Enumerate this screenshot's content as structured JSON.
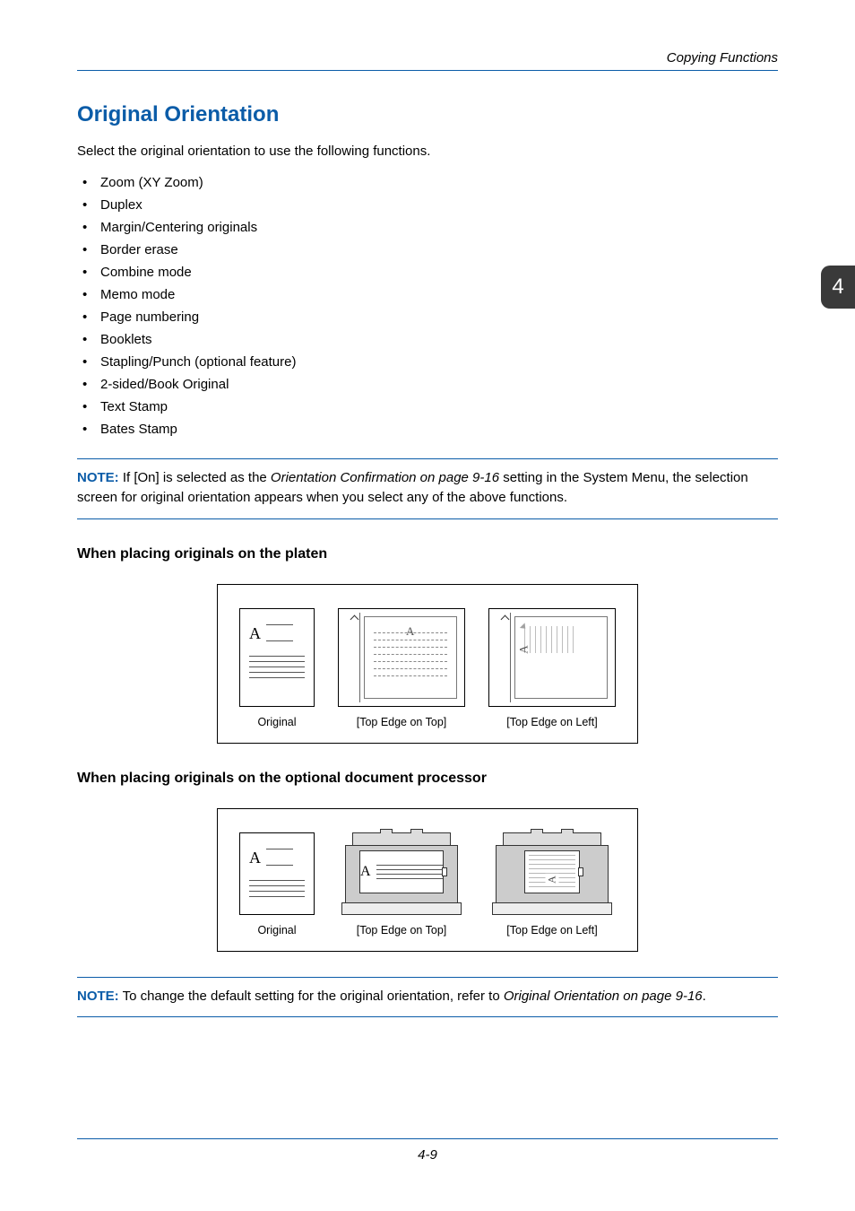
{
  "running_head": "Copying Functions",
  "side_tab": "4",
  "title": "Original Orientation",
  "intro": "Select the original orientation to use the following functions.",
  "bullets": [
    "Zoom (XY Zoom)",
    "Duplex",
    "Margin/Centering originals",
    "Border erase",
    "Combine mode",
    "Memo mode",
    "Page numbering",
    "Booklets",
    "Stapling/Punch (optional feature)",
    "2-sided/Book Original",
    "Text Stamp",
    "Bates Stamp"
  ],
  "note1": {
    "label": "NOTE:",
    "before": " If [On] is selected as the ",
    "italic": "Orientation Confirmation on page 9-16",
    "after": " setting in the System Menu, the selection screen for original orientation appears when you select any of the above functions."
  },
  "subhead1": "When placing originals on the platen",
  "fig1": {
    "c1": "Original",
    "c2": "[Top Edge on Top]",
    "c3": "[Top Edge on Left]"
  },
  "subhead2": "When placing originals on the optional document processor",
  "fig2": {
    "c1": "Original",
    "c2": "[Top Edge on Top]",
    "c3": "[Top Edge on Left]"
  },
  "note2": {
    "label": "NOTE:",
    "before": " To change the default setting for the original orientation, refer to ",
    "italic": "Original Orientation on page 9-16",
    "after": "."
  },
  "glyph_A": "A",
  "page_number": "4-9"
}
